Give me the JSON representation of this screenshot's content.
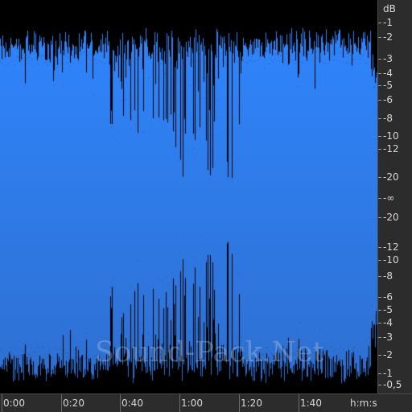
{
  "colors": {
    "background": "#000000",
    "waveform_top": "#2f86ff",
    "waveform_bottom": "#2e6fd0",
    "scale_bg": "#2c2c2c",
    "scale_text": "#d8d8d8"
  },
  "db_scale": {
    "unit": "dB",
    "labels": [
      "-1",
      "-2",
      "-3",
      "-4",
      "-5",
      "-6",
      "-8",
      "-10",
      "-12",
      "-20",
      "-∞",
      "-20",
      "-12",
      "-10",
      "-8",
      "-6",
      "-5",
      "-4",
      "-3",
      "-2",
      "-1",
      "-0,5"
    ]
  },
  "time_scale": {
    "unit": "h:m:s",
    "labels": [
      "0:00",
      "0:20",
      "0:40",
      "1:00",
      "1:20",
      "1:40"
    ]
  },
  "watermark": "Sound-Pack.Net"
}
